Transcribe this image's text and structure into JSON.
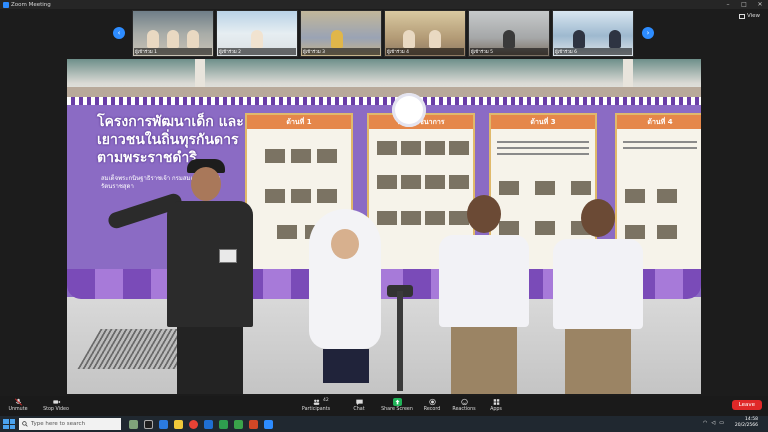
{
  "window": {
    "title": "Zoom Meeting"
  },
  "view_button": {
    "label": "View"
  },
  "participants_strip": [
    {
      "name": "ผู้เข้าร่วม 1"
    },
    {
      "name": "ผู้เข้าร่วม 2"
    },
    {
      "name": "ผู้เข้าร่วม 3"
    },
    {
      "name": "ผู้เข้าร่วม 4"
    },
    {
      "name": "ผู้เข้าร่วม 5"
    },
    {
      "name": "ผู้เข้าร่วม 6"
    }
  ],
  "banner": {
    "headline": "โครงการพัฒนาเด็ก และเยาวชนในถิ่นทุรกันดาร ตามพระราชดำริ",
    "subline": "สมเด็จพระกนิษฐาธิราชเจ้า กรมสมเด็จพระเทพรัตนราชสุดา",
    "boards": [
      {
        "label": "ด้านที่ 1"
      },
      {
        "label": "ด้านโภชนาการ"
      },
      {
        "label": "ด้านที่ 3"
      },
      {
        "label": "ด้านที่ 4"
      }
    ]
  },
  "toolbar": {
    "items": [
      {
        "id": "unmute",
        "label": "Unmute",
        "icon": "microphone-muted-icon"
      },
      {
        "id": "stop-video",
        "label": "Stop Video",
        "icon": "video-camera-icon"
      },
      {
        "id": "participants",
        "label": "Participants",
        "icon": "people-icon",
        "count": "42"
      },
      {
        "id": "chat",
        "label": "Chat",
        "icon": "chat-bubble-icon"
      },
      {
        "id": "share-screen",
        "label": "Share Screen",
        "icon": "share-screen-icon"
      },
      {
        "id": "record",
        "label": "Record",
        "icon": "record-icon"
      },
      {
        "id": "reactions",
        "label": "Reactions",
        "icon": "smiley-icon"
      },
      {
        "id": "apps",
        "label": "Apps",
        "icon": "apps-icon"
      }
    ],
    "leave_label": "Leave"
  },
  "taskbar": {
    "search_placeholder": "Type here to search",
    "time": "14:58",
    "date": "20/2/2566"
  },
  "colors": {
    "zoom_blue": "#2d8cff",
    "share_green": "#20b358",
    "leave_red": "#e02828"
  }
}
